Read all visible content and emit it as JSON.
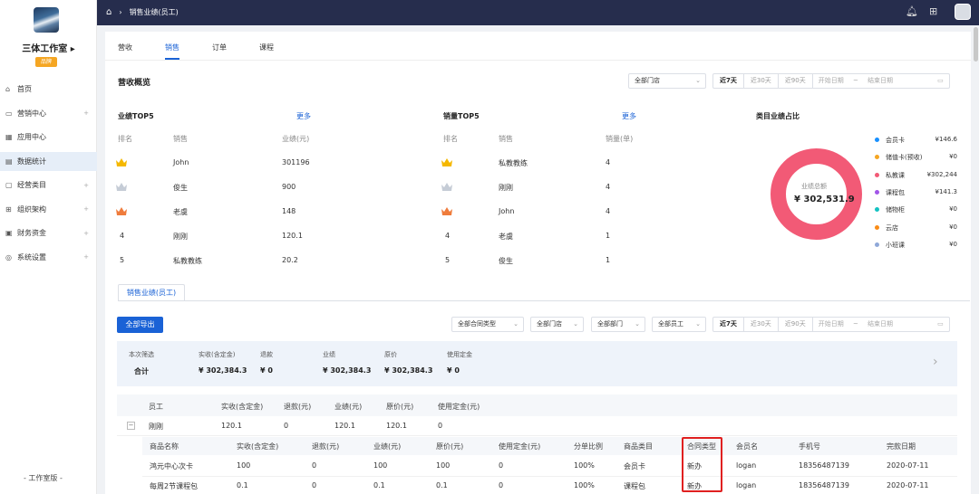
{
  "sidebar": {
    "studio_name": "三体工作室 ▸",
    "badge": "品牌",
    "items": [
      {
        "label": "首页",
        "icon": "home-icon",
        "glyph": "⌂",
        "arrow": false,
        "active": false
      },
      {
        "label": "营销中心",
        "icon": "marketing-icon",
        "glyph": "▭",
        "arrow": true,
        "active": false
      },
      {
        "label": "应用中心",
        "icon": "apps-icon",
        "glyph": "▦",
        "arrow": false,
        "active": false
      },
      {
        "label": "数据统计",
        "icon": "chart-icon",
        "glyph": "▤",
        "arrow": false,
        "active": true
      },
      {
        "label": "经营类目",
        "icon": "category-icon",
        "glyph": "▢",
        "arrow": true,
        "active": false
      },
      {
        "label": "组织架构",
        "icon": "org-icon",
        "glyph": "⊞",
        "arrow": true,
        "active": false
      },
      {
        "label": "财务资金",
        "icon": "finance-icon",
        "glyph": "▣",
        "arrow": true,
        "active": false
      },
      {
        "label": "系统设置",
        "icon": "settings-icon",
        "glyph": "◎",
        "arrow": true,
        "active": false
      }
    ],
    "footer": "- 工作室版 -"
  },
  "topbar": {
    "breadcrumb": "销售业绩(员工)"
  },
  "tabs": [
    "营收",
    "销售",
    "订单",
    "课程"
  ],
  "overview": {
    "title": "营收概览",
    "store_select": "全部门店",
    "range_opts": [
      "近7天",
      "近30天",
      "近90天"
    ],
    "start_date": "开始日期",
    "tilde": "~",
    "end_date": "结束日期"
  },
  "perf_top5": {
    "title": "业绩TOP5",
    "more": "更多",
    "headers": [
      "排名",
      "销售",
      "业绩(元)"
    ],
    "rows": [
      {
        "rank": "",
        "name": "John",
        "value": "301196"
      },
      {
        "rank": "",
        "name": "俊生",
        "value": "900"
      },
      {
        "rank": "",
        "name": "老虞",
        "value": "148"
      },
      {
        "rank": "4",
        "name": "刚刚",
        "value": "120.1"
      },
      {
        "rank": "5",
        "name": "私教教练",
        "value": "20.2"
      }
    ]
  },
  "sales_top5": {
    "title": "销量TOP5",
    "more": "更多",
    "headers": [
      "排名",
      "销售",
      "销量(单)"
    ],
    "rows": [
      {
        "rank": "",
        "name": "私教教练",
        "value": "4"
      },
      {
        "rank": "",
        "name": "刚刚",
        "value": "4"
      },
      {
        "rank": "",
        "name": "John",
        "value": "4"
      },
      {
        "rank": "4",
        "name": "老虞",
        "value": "1"
      },
      {
        "rank": "5",
        "name": "俊生",
        "value": "1"
      }
    ]
  },
  "category": {
    "title": "类目业绩占比",
    "center_label": "业绩总额",
    "center_value": "¥ 302,531.9",
    "legend": [
      {
        "name": "会员卡",
        "value": "¥146.6",
        "color": "#1890ff"
      },
      {
        "name": "储值卡(预收)",
        "value": "¥0",
        "color": "#f5a623"
      },
      {
        "name": "私教课",
        "value": "¥302,244",
        "color": "#f25a76"
      },
      {
        "name": "课程包",
        "value": "¥141.3",
        "color": "#a155e8"
      },
      {
        "name": "储物柜",
        "value": "¥0",
        "color": "#13c2c2"
      },
      {
        "name": "云店",
        "value": "¥0",
        "color": "#fa8c16"
      },
      {
        "name": "小班课",
        "value": "¥0",
        "color": "#8fa8d8"
      }
    ]
  },
  "staff_perf": {
    "subtab": "销售业绩(员工)",
    "export": "全部导出",
    "filters": [
      "全部合同类型",
      "全部门店",
      "全部部门",
      "全部员工"
    ],
    "summary": {
      "label": "本次筛选",
      "total": "合计",
      "cols": [
        {
          "label": "实收(含定金)",
          "value": "¥ 302,384.3"
        },
        {
          "label": "退款",
          "value": "¥ 0"
        },
        {
          "label": "业绩",
          "value": "¥ 302,384.3"
        },
        {
          "label": "原价",
          "value": "¥ 302,384.3"
        },
        {
          "label": "使用定金",
          "value": "¥ 0"
        }
      ],
      "arrow": "›"
    },
    "headers": [
      "员工",
      "实收(含定金)",
      "退款(元)",
      "业绩(元)",
      "原价(元)",
      "使用定金(元)"
    ],
    "row": {
      "toggle": "−",
      "name": "刚刚",
      "values": [
        "120.1",
        "0",
        "120.1",
        "120.1",
        "0"
      ]
    },
    "sub_headers": [
      "商品名称",
      "实收(含定金)",
      "退款(元)",
      "业绩(元)",
      "原价(元)",
      "使用定金(元)",
      "分单比例",
      "商品类目",
      "合同类型",
      "会员名",
      "手机号",
      "完款日期"
    ],
    "sub_rows": [
      [
        "鸿元中心次卡",
        "100",
        "0",
        "100",
        "100",
        "0",
        "100%",
        "会员卡",
        "新办",
        "logan",
        "18356487139",
        "2020-07-11"
      ],
      [
        "每周2节课程包",
        "0.1",
        "0",
        "0.1",
        "0.1",
        "0",
        "100%",
        "课程包",
        "新办",
        "logan",
        "18356487139",
        "2020-07-11"
      ]
    ]
  }
}
